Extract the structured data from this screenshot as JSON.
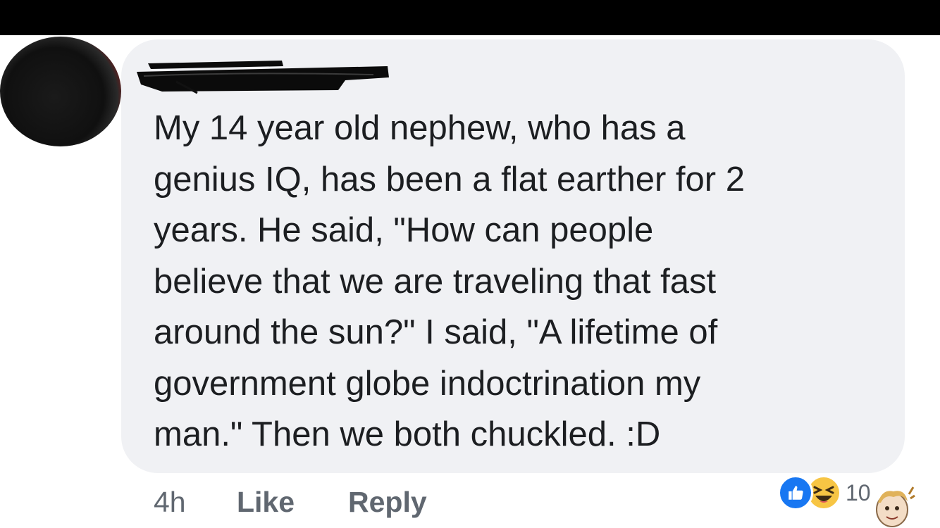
{
  "comment": {
    "text": "My 14 year old nephew, who has a\ngenius IQ, has been a flat earther for 2\nyears. He said, \"How can people\nbelieve that we are traveling that fast\naround the sun?\" I said, \"A lifetime of\ngovernment globe indoctrination my\nman.\" Then we both chuckled. :D"
  },
  "meta": {
    "time": "4h",
    "like_label": "Like",
    "reply_label": "Reply"
  },
  "reactions": {
    "icons": [
      "like-icon",
      "haha-icon"
    ],
    "count": "10"
  },
  "colors": {
    "bubble": "#f0f1f4",
    "text": "#1c1e21",
    "meta": "#606770",
    "like_blue": "#1877f2",
    "haha_yellow": "#f7c544"
  }
}
